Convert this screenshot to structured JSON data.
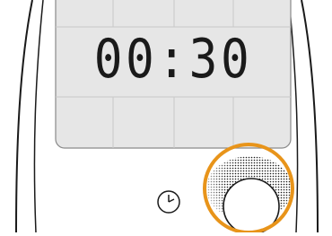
{
  "display": {
    "time": "00:30"
  },
  "icons": {
    "clock": "clock-icon",
    "knob": "rotary-knob"
  },
  "colors": {
    "display_bg": "#e6e6e6",
    "highlight": "#e8941a",
    "outline": "#1a1a1a"
  }
}
